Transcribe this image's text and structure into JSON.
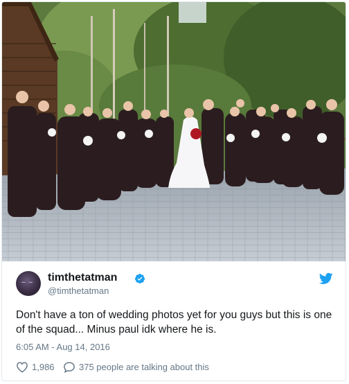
{
  "tweet": {
    "display_name": "timthetatman",
    "handle": "@timthetatman",
    "verified": true,
    "text": "Don't have a ton of wedding photos yet for you guys but this is one of the squad... Minus paul idk where he is.",
    "timestamp": "6:05 AM - Aug 14, 2016",
    "like_count": "1,986",
    "talking_text": "375 people are talking about this"
  },
  "colors": {
    "twitter_blue": "#1da1f2",
    "text_primary": "#14171a",
    "text_secondary": "#657786"
  },
  "icons": {
    "verified": "verified-badge-icon",
    "platform": "twitter-bird-icon",
    "like": "heart-icon",
    "reply": "speech-bubble-icon"
  }
}
